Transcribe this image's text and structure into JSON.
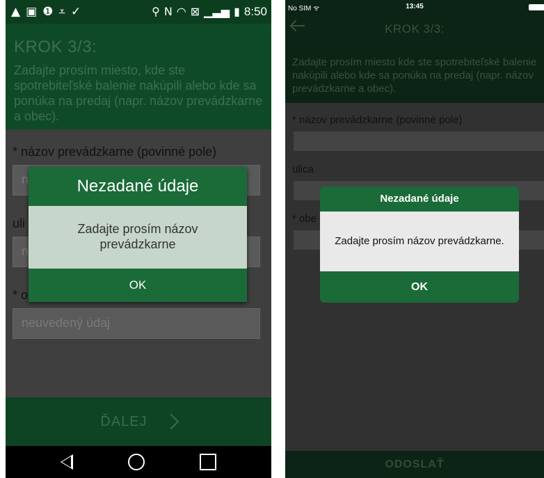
{
  "android": {
    "status_bar": {
      "left_icons": [
        "warning-icon",
        "image-icon",
        "info-icon",
        "download-icon",
        "check-icon"
      ],
      "left_glyphs": [
        "▲",
        "▣",
        "❶",
        "⩡",
        "✓"
      ],
      "right_icons": [
        "location-icon",
        "nfc-icon",
        "wifi-icon",
        "data-icon",
        "signal-icon",
        "battery-icon"
      ],
      "right_glyphs": [
        "⚲",
        "N",
        "◠",
        "⊠",
        "▁▃▅",
        "▮"
      ],
      "time": "8:50"
    },
    "header": {
      "step": "KROK 3/3:",
      "description": "Zadajte prosím miesto, kde ste spotrebiteľské balenie nakúpili alebo kde sa ponúka na predaj (napr. názov prevádzkarne a obec)."
    },
    "form": {
      "field1_label": "* názov prevádzkarne (povinné pole)",
      "field1_placeholder": "n",
      "field2_label": "uli",
      "field2_placeholder": "n",
      "field3_label": "* o",
      "field3_value": "neuvedený údaj"
    },
    "next_button": "ĎALEJ",
    "dialog": {
      "title": "Nezadané údaje",
      "message": "Zadajte prosím názov prevádzkarne",
      "ok": "OK"
    }
  },
  "ios": {
    "status_bar": {
      "carrier": "No SIM ᯤ",
      "time": "13:45"
    },
    "nav": {
      "title": "KROK 3/3:"
    },
    "description": "Zadajte prosím miesto kde ste spotrebiteľské balenie nakúpili alebo kde sa ponúka na predaj (napr. názov prevádzkarne a obec).",
    "form": {
      "field1_label": "* názov prevádzkarne (povinné pole)",
      "field2_label": "ulica",
      "field3_label": "* obe"
    },
    "submit": "ODOSLAŤ",
    "dialog": {
      "title": "Nezadané údaje",
      "message": "Zadajte prosím názov prevádzkarne.",
      "ok": "OK"
    }
  },
  "colors": {
    "dark_green": "#0f4a26",
    "dialog_green": "#1a6b38",
    "overlay_gray": "#3f3f3f"
  }
}
